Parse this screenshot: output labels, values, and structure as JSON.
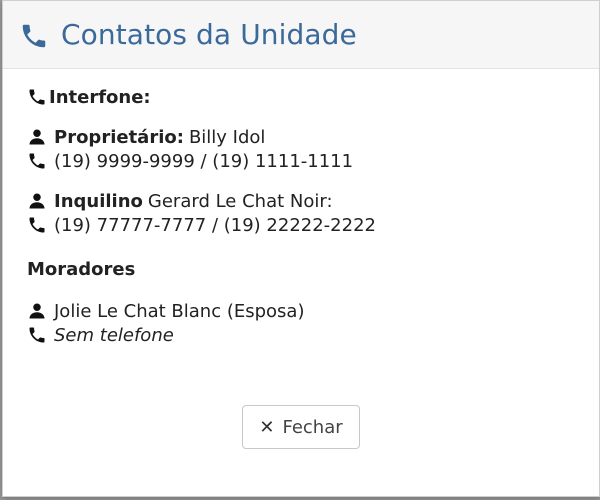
{
  "modal": {
    "title": "Contatos da Unidade",
    "interfone_label": "Interfone:",
    "owner": {
      "label": "Proprietário:",
      "name": "Billy Idol",
      "phones": "(19) 9999-9999 / (19) 1111-1111"
    },
    "tenant": {
      "label": "Inquilino",
      "name": "Gerard Le Chat Noir:",
      "phones": "(19) 77777-7777 / (19) 22222-2222"
    },
    "residents_title": "Moradores",
    "residents": [
      {
        "name": "Jolie Le Chat Blanc (Esposa)",
        "phone": "Sem telefone"
      }
    ],
    "close_label": "Fechar",
    "close_glyph": "✕"
  },
  "colors": {
    "title": "#3b6a9a",
    "header_bg": "#f6f6f6"
  },
  "icons": {
    "header": "phone-icon",
    "person": "user-icon",
    "phone": "phone-icon"
  }
}
